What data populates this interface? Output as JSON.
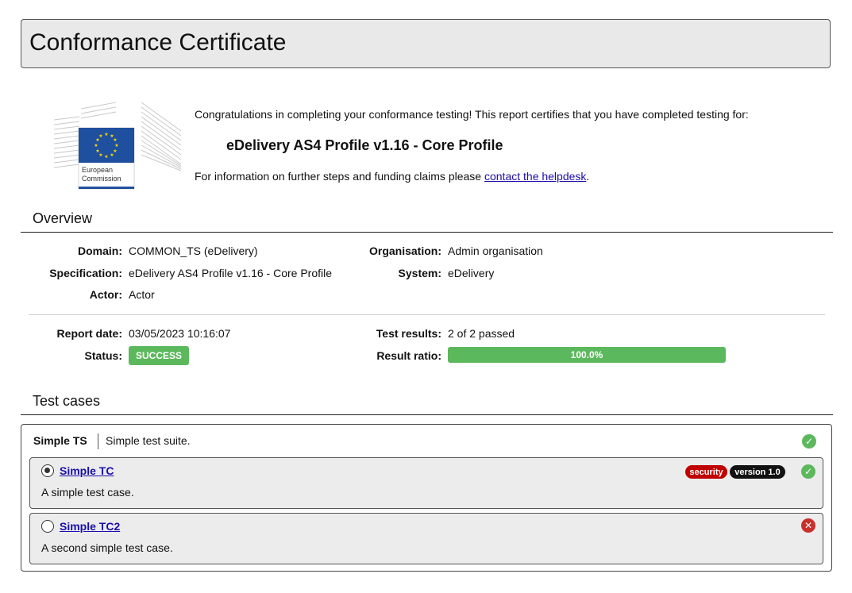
{
  "title": "Conformance Certificate",
  "logo": {
    "line1": "European",
    "line2": "Commission"
  },
  "intro": {
    "congrats": "Congratulations in completing your conformance testing! This report certifies that you have completed testing for:",
    "spec_title": "eDelivery AS4 Profile v1.16 - Core Profile",
    "info_prefix": "For information on further steps and funding claims please ",
    "link_text": "contact the helpdesk",
    "info_suffix": "."
  },
  "overview": {
    "heading": "Overview",
    "domain_label": "Domain:",
    "domain_value": "COMMON_TS (eDelivery)",
    "specification_label": "Specification:",
    "specification_value": "eDelivery AS4 Profile v1.16 - Core Profile",
    "actor_label": "Actor:",
    "actor_value": "Actor",
    "organisation_label": "Organisation:",
    "organisation_value": "Admin organisation",
    "system_label": "System:",
    "system_value": "eDelivery",
    "report_date_label": "Report date:",
    "report_date_value": "03/05/2023 10:16:07",
    "status_label": "Status:",
    "status_value": "SUCCESS",
    "test_results_label": "Test results:",
    "test_results_value": "2 of 2 passed",
    "result_ratio_label": "Result ratio:",
    "result_ratio_text": "100.0%",
    "result_ratio_value": 100.0
  },
  "test_cases": {
    "heading": "Test cases",
    "suite": {
      "name": "Simple TS",
      "description": "Simple test suite."
    },
    "cases": [
      {
        "name": "Simple TC",
        "description": "A simple test case.",
        "tags": [
          "security",
          "version 1.0"
        ]
      },
      {
        "name": "Simple TC2",
        "description": "A second simple test case."
      }
    ]
  },
  "colors": {
    "success": "#5cb85c",
    "failure": "#c9302c",
    "tag_security": "#c00000",
    "tag_version": "#111111",
    "link": "#1a0dab"
  }
}
